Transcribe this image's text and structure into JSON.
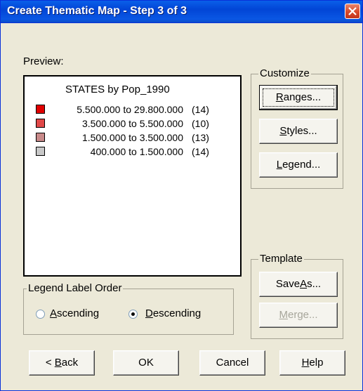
{
  "window": {
    "title": "Create Thematic Map - Step 3 of 3"
  },
  "preview": {
    "label": "Preview:",
    "map_title": "STATES by Pop_1990",
    "legend": [
      {
        "range": "5.500.000 to 29.800.000",
        "count": "(14)",
        "color": "#e00000"
      },
      {
        "range": "3.500.000 to  5.500.000",
        "count": "(10)",
        "color": "#e04848"
      },
      {
        "range": "1.500.000 to  3.500.000",
        "count": "(13)",
        "color": "#c88a8a"
      },
      {
        "range": "400.000 to  1.500.000",
        "count": "(14)",
        "color": "#c8c8c8"
      }
    ]
  },
  "customize": {
    "title": "Customize",
    "ranges": {
      "pre": "",
      "acc": "R",
      "post": "anges..."
    },
    "styles": {
      "pre": "",
      "acc": "S",
      "post": "tyles..."
    },
    "legend": {
      "pre": "",
      "acc": "L",
      "post": "egend..."
    }
  },
  "template": {
    "title": "Template",
    "save_as": {
      "pre": "Save ",
      "acc": "A",
      "post": "s..."
    },
    "merge": {
      "pre": "",
      "acc": "M",
      "post": "erge..."
    }
  },
  "order": {
    "title": "Legend Label Order",
    "ascending": {
      "pre": "",
      "acc": "A",
      "post": "scending"
    },
    "descending": {
      "pre": "",
      "acc": "D",
      "post": "escending"
    },
    "selected": "Descending"
  },
  "footer": {
    "back": {
      "pre": "< ",
      "acc": "B",
      "post": "ack"
    },
    "ok": "OK",
    "cancel": "Cancel",
    "help": {
      "pre": "",
      "acc": "H",
      "post": "elp"
    }
  }
}
